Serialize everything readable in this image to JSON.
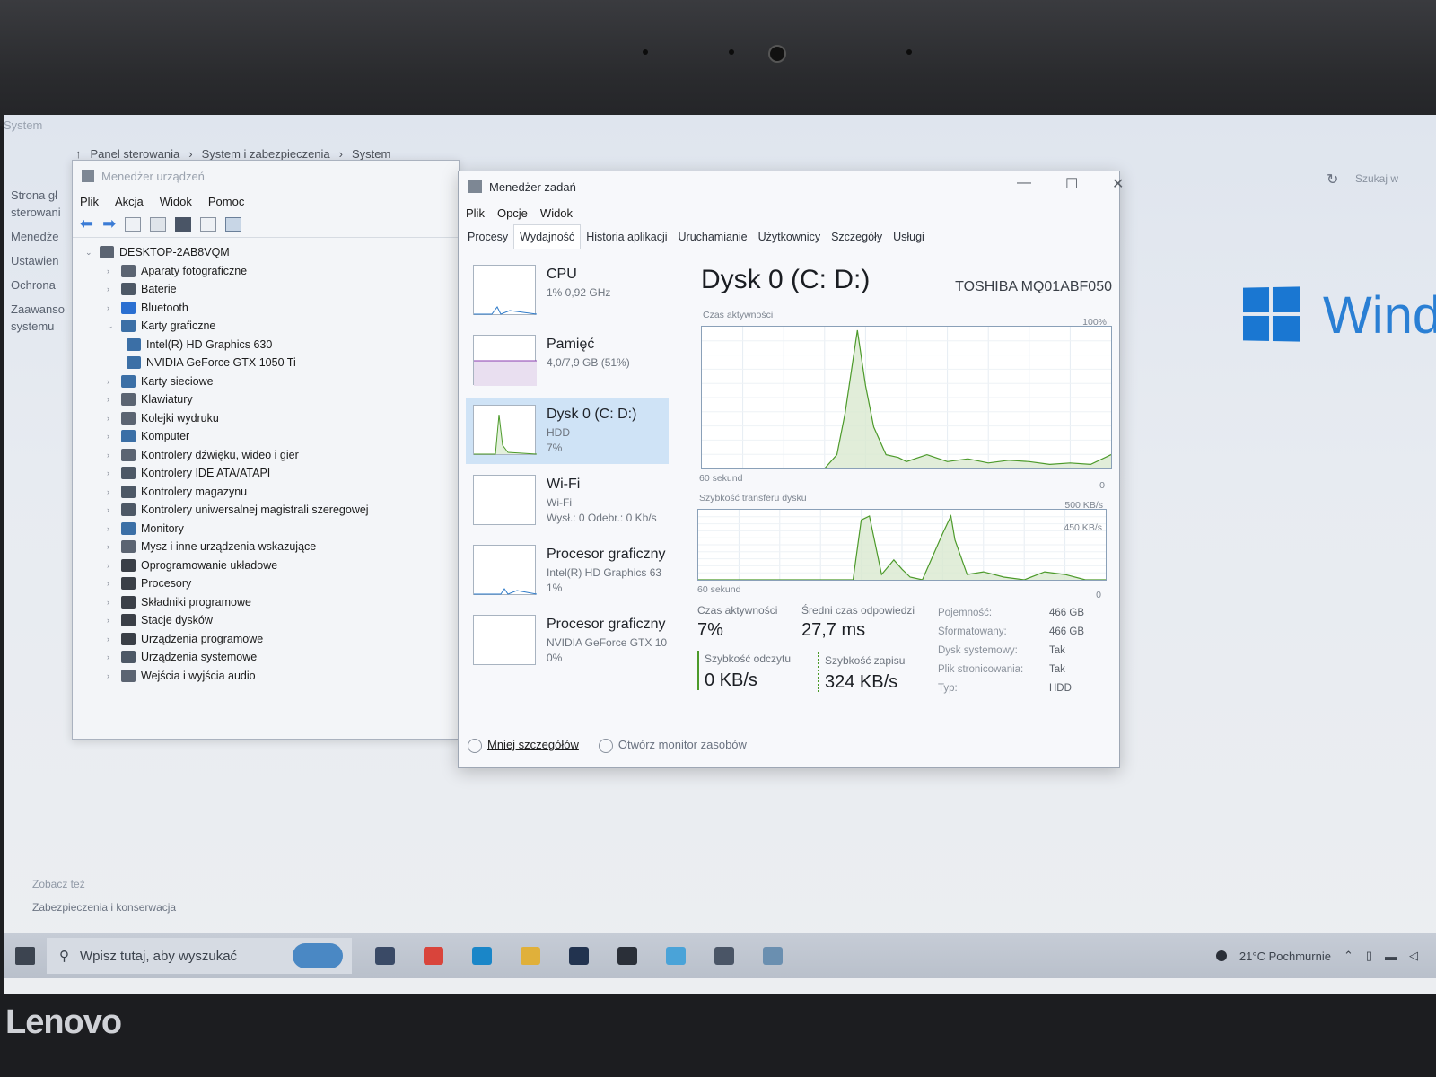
{
  "brand": "Lenovo",
  "system_window": {
    "title": "System",
    "breadcrumbs": [
      "Panel sterowania",
      "System i zabezpieczenia",
      "System"
    ],
    "left_links": [
      "Strona gł sterowani",
      "Menedże",
      "Ustawien",
      "Ochrona",
      "Zaawanso systemu"
    ],
    "search_placeholder": "Szukaj w",
    "see_also": "Zobacz też",
    "see_also_link": "Zabezpieczenia i konserwacja",
    "windows_text": "Wind"
  },
  "device_manager": {
    "title": "Menedżer urządzeń",
    "menu": [
      "Plik",
      "Akcja",
      "Widok",
      "Pomoc"
    ],
    "root": "DESKTOP-2AB8VQM",
    "items": [
      {
        "label": "Aparaty fotograficzne",
        "color": "#5b6472"
      },
      {
        "label": "Baterie",
        "color": "#4d5866"
      },
      {
        "label": "Bluetooth",
        "color": "#2a6fd1"
      },
      {
        "label": "Karty graficzne",
        "color": "#3b6fa6",
        "expanded": true,
        "children": [
          "Intel(R) HD Graphics 630",
          "NVIDIA GeForce GTX 1050 Ti"
        ]
      },
      {
        "label": "Karty sieciowe",
        "color": "#3b6fa6"
      },
      {
        "label": "Klawiatury",
        "color": "#5b6472"
      },
      {
        "label": "Kolejki wydruku",
        "color": "#5b6472"
      },
      {
        "label": "Komputer",
        "color": "#3b6fa6"
      },
      {
        "label": "Kontrolery dźwięku, wideo i gier",
        "color": "#5b6472"
      },
      {
        "label": "Kontrolery IDE ATA/ATAPI",
        "color": "#4d5866"
      },
      {
        "label": "Kontrolery magazynu",
        "color": "#4d5866"
      },
      {
        "label": "Kontrolery uniwersalnej magistrali szeregowej",
        "color": "#4d5866"
      },
      {
        "label": "Monitory",
        "color": "#3b6fa6"
      },
      {
        "label": "Mysz i inne urządzenia wskazujące",
        "color": "#5b6472"
      },
      {
        "label": "Oprogramowanie układowe",
        "color": "#3a3f47"
      },
      {
        "label": "Procesory",
        "color": "#3a3f47"
      },
      {
        "label": "Składniki programowe",
        "color": "#3a3f47"
      },
      {
        "label": "Stacje dysków",
        "color": "#3a3f47"
      },
      {
        "label": "Urządzenia programowe",
        "color": "#3a3f47"
      },
      {
        "label": "Urządzenia systemowe",
        "color": "#4d5866"
      },
      {
        "label": "Wejścia i wyjścia audio",
        "color": "#5b6472"
      }
    ]
  },
  "task_manager": {
    "title": "Menedżer zadań",
    "menu": [
      "Plik",
      "Opcje",
      "Widok"
    ],
    "tabs": [
      "Procesy",
      "Wydajność",
      "Historia aplikacji",
      "Uruchamianie",
      "Użytkownicy",
      "Szczegóły",
      "Usługi"
    ],
    "active_tab": "Wydajność",
    "resources": [
      {
        "name": "CPU",
        "sub1": "1% 0,92 GHz",
        "sub2": ""
      },
      {
        "name": "Pamięć",
        "sub1": "4,0/7,9 GB (51%)",
        "sub2": ""
      },
      {
        "name": "Dysk 0 (C: D:)",
        "sub1": "HDD",
        "sub2": "7%"
      },
      {
        "name": "Wi-Fi",
        "sub1": "Wi-Fi",
        "sub2": "Wysł.: 0 Odebr.: 0 Kb/s"
      },
      {
        "name": "Procesor graficzny",
        "sub1": "Intel(R) HD Graphics 63",
        "sub2": "1%"
      },
      {
        "name": "Procesor graficzny",
        "sub1": "NVIDIA GeForce GTX 10",
        "sub2": "0%"
      }
    ],
    "disk": {
      "title": "Dysk 0 (C: D:)",
      "model": "TOSHIBA MQ01ABF050",
      "activity_label": "Czas aktywności",
      "activity_max": "100%",
      "activity_min": "0",
      "time_label": "60 sekund",
      "transfer_label": "Szybkość transferu dysku",
      "transfer_max": "500 KB/s",
      "transfer_line": "450 KB/s",
      "transfer_min": "0",
      "stats": {
        "active_time_label": "Czas aktywności",
        "active_time": "7%",
        "avg_response_label": "Średni czas odpowiedzi",
        "avg_response": "27,7 ms",
        "read_label": "Szybkość odczytu",
        "read": "0 KB/s",
        "write_label": "Szybkość zapisu",
        "write": "324 KB/s"
      },
      "properties": [
        {
          "key": "Pojemność:",
          "value": "466 GB"
        },
        {
          "key": "Sformatowany:",
          "value": "466 GB"
        },
        {
          "key": "Dysk systemowy:",
          "value": "Tak"
        },
        {
          "key": "Plik stronicowania:",
          "value": "Tak"
        },
        {
          "key": "Typ:",
          "value": "HDD"
        }
      ]
    },
    "footer_less": "Mniej szczegółów",
    "footer_monitor": "Otwórz monitor zasobów"
  },
  "chart_data": [
    {
      "type": "area",
      "title": "Czas aktywności",
      "x": [
        0,
        5,
        10,
        15,
        20,
        25,
        30,
        33,
        35,
        38,
        40,
        42,
        45,
        48,
        50,
        55,
        60,
        65,
        70,
        75,
        80,
        85,
        90,
        95,
        100
      ],
      "y": [
        0,
        0,
        0,
        0,
        0,
        0,
        0,
        10,
        40,
        100,
        60,
        30,
        10,
        8,
        5,
        10,
        5,
        7,
        4,
        6,
        5,
        3,
        4,
        3,
        10
      ],
      "ylim": [
        0,
        100
      ]
    },
    {
      "type": "area",
      "title": "Szybkość transferu dysku",
      "x": [
        0,
        10,
        20,
        30,
        38,
        40,
        42,
        45,
        48,
        50,
        52,
        55,
        60,
        62,
        63,
        66,
        70,
        75,
        80,
        85,
        90,
        95,
        100
      ],
      "y": [
        0,
        0,
        0,
        0,
        0,
        450,
        480,
        40,
        150,
        80,
        20,
        0,
        350,
        480,
        300,
        40,
        60,
        20,
        0,
        60,
        40,
        0,
        0
      ],
      "ylim": [
        0,
        500
      ]
    }
  ],
  "taskbar": {
    "search_placeholder": "Wpisz tutaj, aby wyszukać",
    "weather": "21°C Pochmurnie",
    "apps": [
      {
        "name": "task-view",
        "color": "#3a4a66"
      },
      {
        "name": "chrome",
        "color": "#d9443b"
      },
      {
        "name": "edge",
        "color": "#1a86c8"
      },
      {
        "name": "file-explorer",
        "color": "#e0b03a"
      },
      {
        "name": "store",
        "color": "#22334f"
      },
      {
        "name": "mail",
        "color": "#2a2f38"
      },
      {
        "name": "monitor",
        "color": "#4aa3d8"
      },
      {
        "name": "device-manager",
        "color": "#4a5566"
      },
      {
        "name": "task-manager",
        "color": "#6a8fb0"
      }
    ]
  }
}
